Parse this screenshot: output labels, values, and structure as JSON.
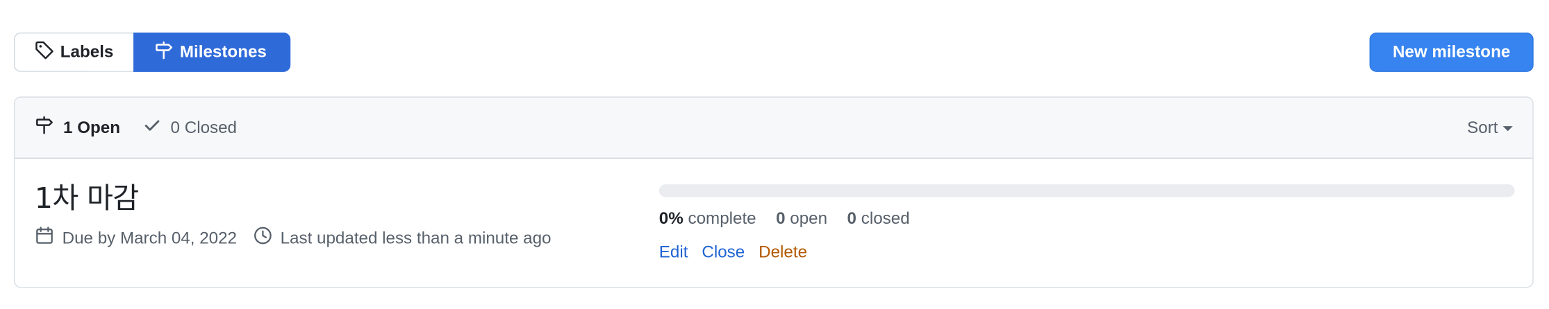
{
  "subnav": {
    "labels": "Labels",
    "milestones": "Milestones"
  },
  "new_milestone": "New milestone",
  "header": {
    "open_label": "1 Open",
    "closed_label": "0 Closed",
    "sort_label": "Sort"
  },
  "milestone": {
    "title": "1차 마감",
    "due": "Due by March 04, 2022",
    "updated": "Last updated less than a minute ago",
    "progress_percent": 0,
    "complete_value": "0%",
    "complete_label": "complete",
    "open_value": "0",
    "open_label": "open",
    "closed_value": "0",
    "closed_label": "closed",
    "actions": {
      "edit": "Edit",
      "close": "Close",
      "delete": "Delete"
    }
  },
  "colors": {
    "accent": "#2f6ad9",
    "primary_button": "#3784f0",
    "link": "#1f63d3",
    "danger": "#b35900"
  },
  "icons": {
    "labels": "tag-icon",
    "milestones": "milestone-icon",
    "open": "milestone-icon",
    "closed": "check-icon",
    "due": "calendar-icon",
    "updated": "clock-icon"
  }
}
